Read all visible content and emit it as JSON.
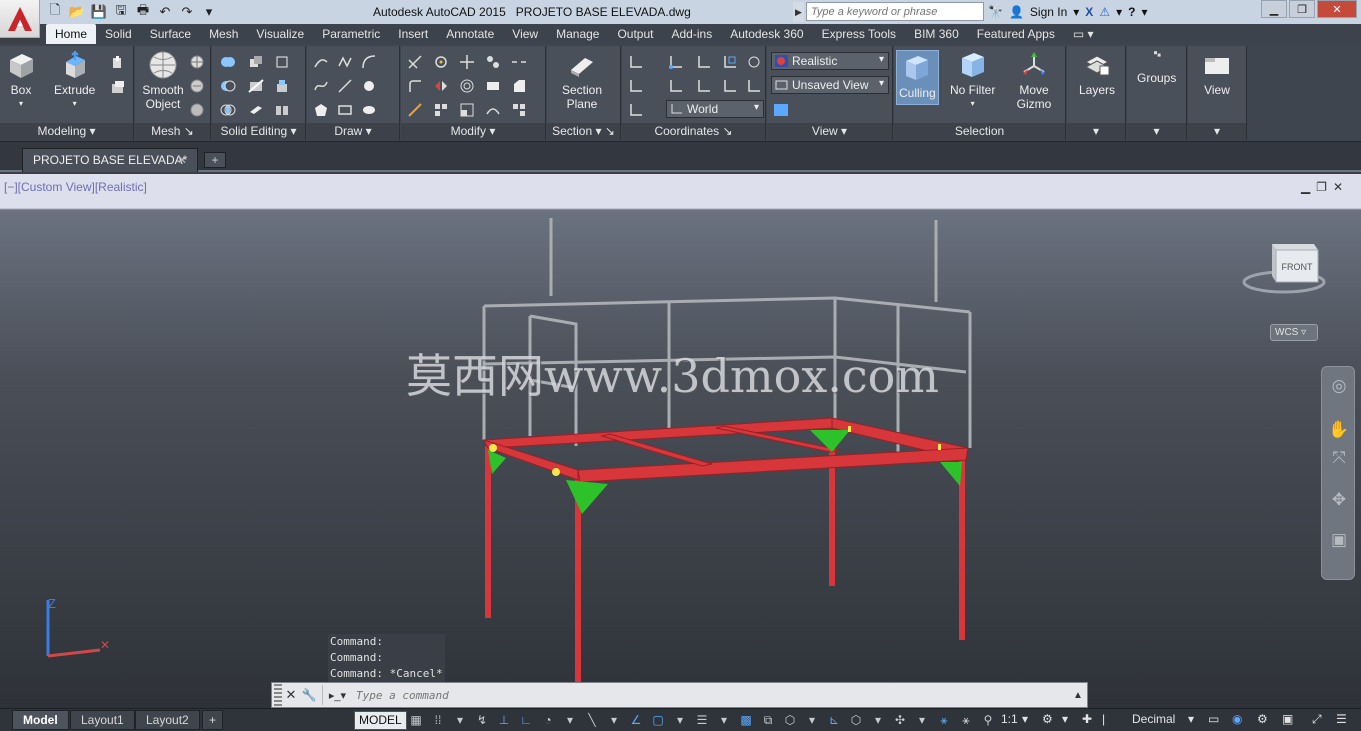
{
  "titlebar": {
    "app_title": "Autodesk AutoCAD 2015",
    "file_name": "PROJETO BASE ELEVADA.dwg",
    "search_placeholder": "Type a keyword or phrase",
    "sign_in": "Sign In"
  },
  "ribbon": {
    "tabs": [
      "Home",
      "Solid",
      "Surface",
      "Mesh",
      "Visualize",
      "Parametric",
      "Insert",
      "Annotate",
      "View",
      "Manage",
      "Output",
      "Add-ins",
      "Autodesk 360",
      "Express Tools",
      "BIM 360",
      "Featured Apps"
    ],
    "active_tab": "Home",
    "panels": {
      "modeling": "Modeling",
      "mesh": "Mesh",
      "solid_editing": "Solid Editing",
      "draw": "Draw",
      "modify": "Modify",
      "section": "Section",
      "coordinates": "Coordinates",
      "view": "View",
      "selection": "Selection"
    },
    "buttons": {
      "box": "Box",
      "extrude": "Extrude",
      "smooth_object": "Smooth Object",
      "section_plane": "Section Plane",
      "culling": "Culling",
      "no_filter": "No Filter",
      "move_gizmo": "Move Gizmo",
      "layers": "Layers",
      "groups": "Groups",
      "view": "View"
    },
    "dropdowns": {
      "visual_style": "Realistic",
      "named_view": "Unsaved View",
      "ucs": "World"
    }
  },
  "doc_tab": {
    "label": "PROJETO BASE ELEVADA*"
  },
  "viewport": {
    "label": "[−][Custom View][Realistic]",
    "viewcube_face": "FRONT",
    "wcs": "WCS",
    "watermark": "莫西网www.3dmox.com",
    "axis_z": "Z"
  },
  "command": {
    "history": [
      "Command:",
      "Command:",
      "Command: *Cancel*"
    ],
    "placeholder": "Type a command"
  },
  "statusbar": {
    "layout_tabs": [
      "Model",
      "Layout1",
      "Layout2"
    ],
    "active_layout": "Model",
    "space": "MODEL",
    "scale": "1:1",
    "units": "Decimal"
  },
  "colors": {
    "steel_red": "#d7373b",
    "gusset_green": "#2ec22a",
    "rail_grey": "#a9adb2",
    "accent_blue": "#5aa8ff"
  }
}
